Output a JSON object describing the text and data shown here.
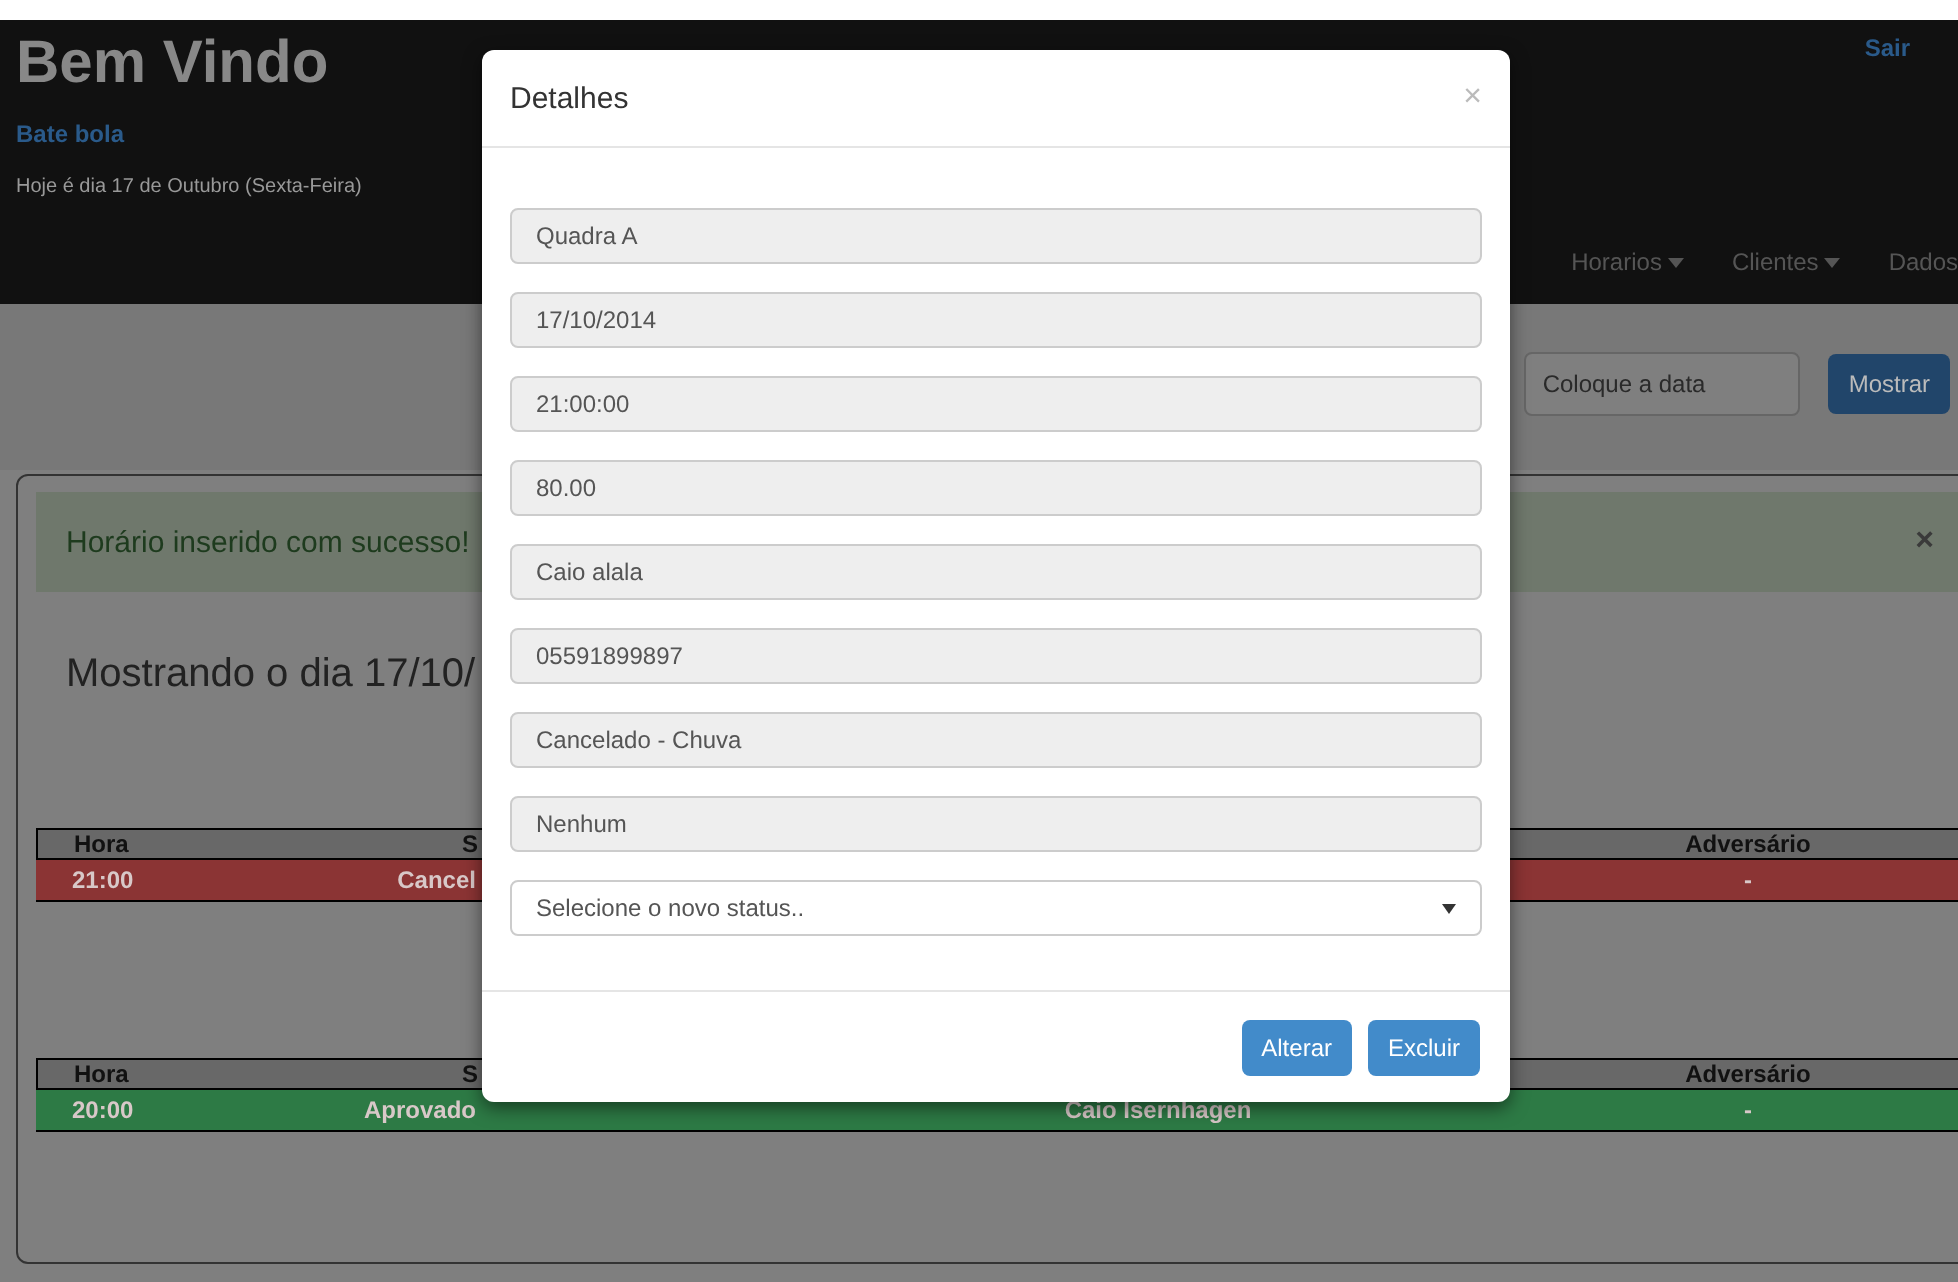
{
  "header": {
    "title": "Bem Vindo",
    "subtitle": "Bate bola",
    "date_text": "Hoje é dia 17 de Outubro (Sexta-Feira)",
    "logout": "Sair",
    "nav": [
      {
        "label": "Horarios",
        "dropdown": true
      },
      {
        "label": "Clientes",
        "dropdown": true
      },
      {
        "label": "Dados",
        "dropdown": false
      }
    ]
  },
  "search": {
    "placeholder": "Coloque a data",
    "button": "Mostrar"
  },
  "alert": {
    "message": "Horário inserido com sucesso!",
    "close": "×"
  },
  "heading": "Mostrando o dia 17/10/",
  "tables": [
    {
      "header": {
        "hora": "Hora",
        "column_2": "S",
        "adversario": "Adversário"
      },
      "rows": [
        {
          "hora": "21:00",
          "column_2": "Cancel",
          "adversario": "-",
          "color": "#8b3434"
        }
      ]
    },
    {
      "header": {
        "hora": "Hora",
        "column_2": "S",
        "adversario": "Adversário"
      },
      "rows": [
        {
          "hora": "20:00",
          "column_2": "Aprovado",
          "column_3": "Caio Isernhagen",
          "adversario": "-",
          "color": "#2d7a45"
        }
      ]
    }
  ],
  "modal": {
    "title": "Detalhes",
    "close": "×",
    "fields": [
      {
        "kind": "readonly",
        "value": "Quadra A"
      },
      {
        "kind": "readonly",
        "value": "17/10/2014"
      },
      {
        "kind": "readonly",
        "value": "21:00:00"
      },
      {
        "kind": "readonly",
        "value": "80.00"
      },
      {
        "kind": "readonly",
        "value": "Caio alala"
      },
      {
        "kind": "readonly",
        "value": "05591899897"
      },
      {
        "kind": "readonly",
        "value": "Cancelado - Chuva"
      },
      {
        "kind": "readonly",
        "value": "Nenhum"
      },
      {
        "kind": "select",
        "value": "Selecione o novo status.."
      }
    ],
    "buttons": [
      "Alterar",
      "Excluir"
    ]
  }
}
